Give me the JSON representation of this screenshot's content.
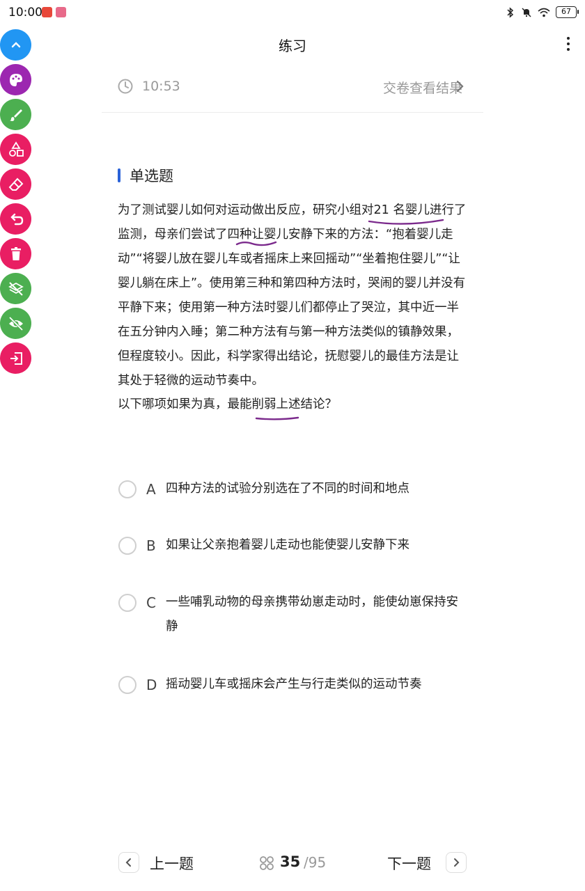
{
  "status_bar": {
    "time": "10:00",
    "battery": "67"
  },
  "header": {
    "title": "练习"
  },
  "timer": {
    "time": "10:53",
    "submit_label": "交卷查看结果"
  },
  "question": {
    "type_label": "单选题",
    "text": "为了测试婴儿如何对运动做出反应，研究小组对21 名婴儿进行了监测，母亲们尝试了四种让婴儿安静下来的方法：“抱着婴儿走动”“将婴儿放在婴儿车或者摇床上来回摇动”“坐着抱住婴儿”“让婴儿躺在床上”。使用第三种和第四种方法时，哭闹的婴儿并没有平静下来；使用第一种方法时婴儿们都停止了哭泣，其中近一半在五分钟内入睡；第二种方法有与第一种方法类似的镇静效果，但程度较小。因此，科学家得出结论，抚慰婴儿的最佳方法是让其处于轻微的运动节奏中。",
    "prompt": "以下哪项如果为真，最能削弱上述结论？"
  },
  "options": [
    {
      "letter": "A",
      "text": "四种方法的试验分别选在了不同的时间和地点"
    },
    {
      "letter": "B",
      "text": "如果让父亲抱着婴儿走动也能使婴儿安静下来"
    },
    {
      "letter": "C",
      "text": "一些哺乳动物的母亲携带幼崽走动时，能使幼崽保持安静"
    },
    {
      "letter": "D",
      "text": "摇动婴儿车或摇床会产生与行走类似的运动节奏"
    }
  ],
  "toolbar": [
    {
      "icon": "chevron-up-icon",
      "color": "#2196f3"
    },
    {
      "icon": "palette-icon",
      "color": "#9c27b0"
    },
    {
      "icon": "brush-icon",
      "color": "#4caf50"
    },
    {
      "icon": "shapes-icon",
      "color": "#e91e63"
    },
    {
      "icon": "eraser-icon",
      "color": "#e91e63"
    },
    {
      "icon": "undo-icon",
      "color": "#e91e63"
    },
    {
      "icon": "trash-icon",
      "color": "#e91e63"
    },
    {
      "icon": "layers-off-icon",
      "color": "#4caf50"
    },
    {
      "icon": "eye-off-icon",
      "color": "#4caf50"
    },
    {
      "icon": "exit-icon",
      "color": "#e91e63"
    }
  ],
  "footer": {
    "prev_label": "上一题",
    "next_label": "下一题",
    "current_page": "35",
    "total_pages": "/95"
  },
  "colors": {
    "accent_blue": "#2a62d8",
    "annotation_purple": "#7b2a8c",
    "muted_text": "#999999"
  }
}
